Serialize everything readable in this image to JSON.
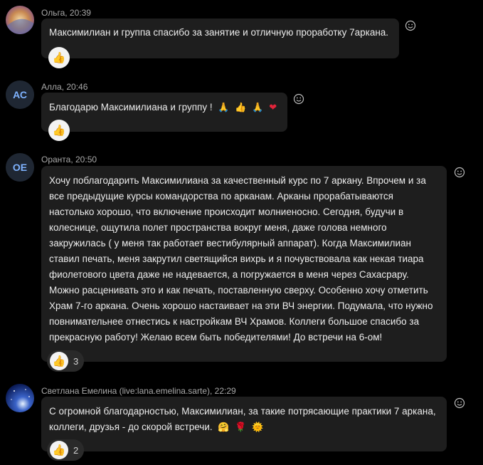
{
  "messages": [
    {
      "author": "Ольга",
      "time": "20:39",
      "meta": "Ольга, 20:39",
      "avatar": "photo",
      "lines": [
        "Максимилиан и группа спасибо за занятие и отличную проработку 7аркана."
      ],
      "reaction": {
        "icon": "thumbs-up",
        "count": ""
      }
    },
    {
      "author": "Алла",
      "time": "20:46",
      "meta": "Алла, 20:46",
      "avatar_initials": "АС",
      "lines": [
        "Благодарю Максимилиана и группу !"
      ],
      "emoji": [
        "🙏",
        "👍",
        "🙏",
        "❤"
      ],
      "reaction": {
        "icon": "thumbs-up",
        "count": ""
      }
    },
    {
      "author": "Оранта",
      "time": "20:50",
      "meta": "Оранта, 20:50",
      "avatar_initials": "OE",
      "lines": [
        "Хочу поблагодарить Максимилиана за качественный курс по 7 аркану. Впрочем и за",
        "все предыдущие курсы командорства по арканам. Арканы прорабатываются",
        "настолько хорошо, что включение происходит молниеносно. Сегодня, будучи в",
        "колеснице, ощутила полет пространства вокруг меня, даже голова немного",
        "закружилась ( у меня так работает вестибулярный аппарат). Когда Максимилиан",
        "ставил печать, меня закрутил светящийся вихрь и я почувствовала как некая тиара",
        "фиолетового цвета даже не надевается, а погружается в меня через Сахасрару.",
        "Можно расценивать это и как печать, поставленную сверху. Особенно хочу отметить",
        "Храм 7-го аркана. Очень хорошо настаивает на эти ВЧ энергии. Подумала, что нужно",
        "повнимательнее отнестись к настройкам ВЧ Храмов. Коллеги большое спасибо за",
        "прекрасную работу! Желаю всем быть победителями! До встречи на 6-ом!"
      ],
      "reaction": {
        "icon": "thumbs-up",
        "count": "3"
      }
    },
    {
      "author": "Светлана Емелина (live:lana.emelina.sarte)",
      "time": "22:29",
      "meta": "Светлана Емелина (live:lana.emelina.sarte), 22:29",
      "avatar": "photo",
      "lines": [
        "С огромной благодарностью, Максимилиан, за такие потрясающие практики 7 аркана,",
        "коллеги, друзья - до скорой встречи."
      ],
      "emoji": [
        "🤗",
        "🌹",
        "🌞"
      ],
      "reaction": {
        "icon": "thumbs-up",
        "count": "2"
      }
    }
  ],
  "colors": {
    "background": "#000000",
    "bubble": "#1e1e1e",
    "initials": "#7fb3ff",
    "meta": "#a9a9a9"
  }
}
